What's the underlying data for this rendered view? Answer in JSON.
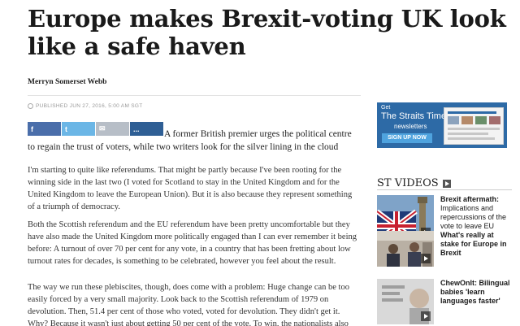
{
  "article": {
    "headline": "Europe makes Brexit-voting UK look like a safe haven",
    "byline": "Merryn Somerset Webb",
    "published": "PUBLISHED JUN 27, 2016, 5:00 AM SGT",
    "share_text": "A former British premier urges the political centre to regain the trust of voters, while two writers look for the silver lining in the cloud",
    "paragraphs": [
      "I'm starting to quite like referendums. That might be partly because I've been rooting for the winning side in the last two (I voted for Scotland to stay in the United Kingdom and for the United Kingdom to leave the European Union). But it is also because they represent something of a triumph of democracy.",
      "Both the Scottish referendum and the EU referendum have been pretty uncomfortable but they have also made the United Kingdom more politically engaged than I can ever remember it being before: A turnout of over 70 per cent for any vote, in a country that has been fretting about low turnout rates for decades, is something to be celebrated, however you feel about the result.",
      "The way we run these plebiscites, though, does come with a problem: Huge change can be too easily forced by a very small majority. Look back to the Scottish referendum of 1979 on devolution. Then, 51.4 per cent of those who voted, voted for devolution. They didn't get it. Why? Because it wasn't just about getting 50 per cent of the vote. To win, the nationalists also"
    ]
  },
  "share": {
    "facebook": "f",
    "twitter": "t",
    "email": "✉",
    "more": "..."
  },
  "ad": {
    "get": "Get",
    "brand": "The Straits Times",
    "newsletters": "newsletters",
    "button": "SIGN UP NOW"
  },
  "videos": {
    "title": "ST VIDEOS",
    "items": [
      {
        "title_bold": "Brexit aftermath:",
        "title": "Implications and repercussions of the vote to leave EU"
      },
      {
        "title": "What's really at stake for Europe in Brexit"
      },
      {
        "title": "ChewOnIt: Bilingual babies 'learn languages faster'"
      }
    ]
  }
}
